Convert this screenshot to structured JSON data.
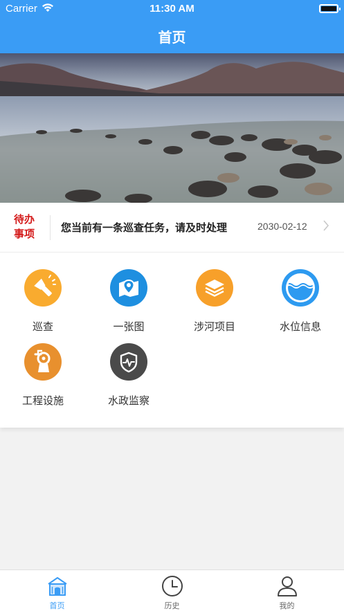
{
  "status_bar": {
    "carrier": "Carrier",
    "time": "11:30 AM"
  },
  "nav": {
    "title": "首页"
  },
  "notice": {
    "tag": "待办事项",
    "message": "您当前有一条巡查任务，请及时处理",
    "date": "2030-02-12"
  },
  "grid": {
    "items": [
      {
        "label": "巡查",
        "icon": "flashlight-icon",
        "color": "#f9ab2f"
      },
      {
        "label": "一张图",
        "icon": "map-pin-icon",
        "color": "#1e8fe0"
      },
      {
        "label": "涉河项目",
        "icon": "layers-icon",
        "color": "#f7a02a"
      },
      {
        "label": "水位信息",
        "icon": "water-level-icon",
        "color": "#2d9af0"
      },
      {
        "label": "工程设施",
        "icon": "pump-icon",
        "color": "#e8902e"
      },
      {
        "label": "水政监察",
        "icon": "shield-icon",
        "color": "#4a4a4a"
      }
    ]
  },
  "tabbar": {
    "tabs": [
      {
        "label": "首页",
        "icon": "home-icon",
        "active": true
      },
      {
        "label": "历史",
        "icon": "clock-icon",
        "active": false
      },
      {
        "label": "我的",
        "icon": "user-icon",
        "active": false
      }
    ]
  },
  "colors": {
    "primary": "#3a9cf5",
    "alert": "#d41a1a"
  }
}
